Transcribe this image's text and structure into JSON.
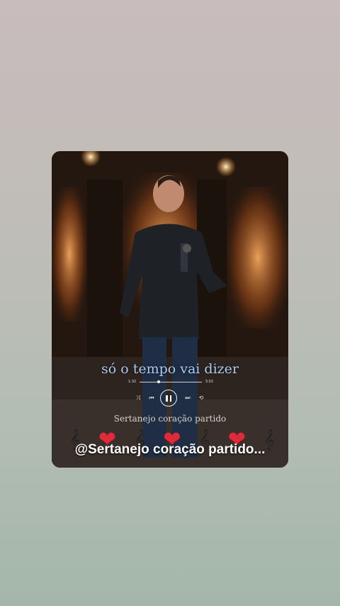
{
  "post": {
    "lyric": "só o tempo vai dizer",
    "subtitle": "Sertanejo coração partido",
    "handle": "@Sertanejo coração partido...",
    "playback_progress": 0.28
  },
  "player": {
    "elapsed": "1:32",
    "duration": "3:02",
    "shuffle_icon": "shuffle-icon",
    "prev_icon": "skip-previous-icon",
    "pause_icon": "pause-icon",
    "next_icon": "skip-next-icon",
    "repeat_icon": "repeat-icon"
  },
  "decorations": [
    "treble-clef-icon",
    "heart-icon",
    "treble-clef-icon",
    "heart-icon",
    "treble-clef-icon",
    "heart-icon",
    "treble-clef-icon"
  ],
  "colors": {
    "lyric": "#a9c8f0",
    "heart": "#e02a3a"
  }
}
